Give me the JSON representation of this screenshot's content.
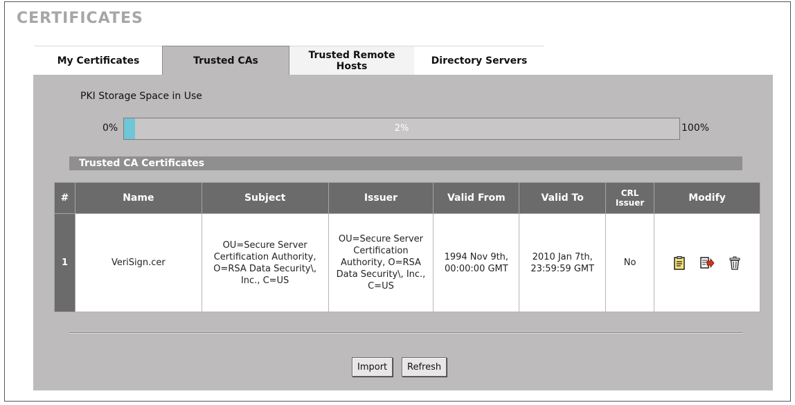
{
  "page": {
    "title": "CERTIFICATES"
  },
  "tabs": [
    {
      "label": "My Certificates",
      "active": false
    },
    {
      "label": "Trusted CAs",
      "active": true
    },
    {
      "label": "Trusted Remote Hosts",
      "active": false
    },
    {
      "label": "Directory Servers",
      "active": false
    }
  ],
  "storage": {
    "label": "PKI Storage Space in Use",
    "min_label": "0%",
    "max_label": "100%",
    "used_percent": 2,
    "used_label": "2%",
    "fill_color": "#6fc6d6"
  },
  "section": {
    "title": "Trusted CA Certificates"
  },
  "table": {
    "headers": {
      "index": "#",
      "name": "Name",
      "subject": "Subject",
      "issuer": "Issuer",
      "valid_from": "Valid From",
      "valid_to": "Valid To",
      "crl_issuer": "CRL Issuer",
      "modify": "Modify"
    },
    "rows": [
      {
        "index": "1",
        "name": "VeriSign.cer",
        "subject": "OU=Secure Server Certification Authority, O=RSA Data Security\\, Inc., C=US",
        "issuer": "OU=Secure Server Certification Authority, O=RSA Data Security\\, Inc., C=US",
        "valid_from": "1994 Nov 9th, 00:00:00 GMT",
        "valid_to": "2010 Jan 7th, 23:59:59 GMT",
        "crl_issuer": "No",
        "actions": [
          "details-icon",
          "export-icon",
          "delete-icon"
        ]
      }
    ]
  },
  "buttons": {
    "import": "Import",
    "refresh": "Refresh"
  }
}
